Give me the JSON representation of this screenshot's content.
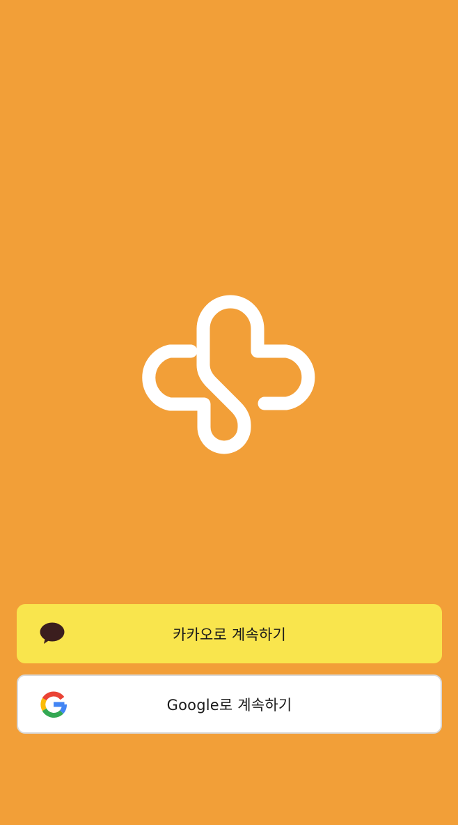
{
  "splash": {
    "logo_icon": "app-logo-plus-icon"
  },
  "login": {
    "kakao": {
      "label": "카카오로 계속하기",
      "icon": "kakao-speech-bubble-icon",
      "bg_color": "#f9e54d"
    },
    "google": {
      "label": "Google로 계속하기",
      "icon": "google-g-icon",
      "bg_color": "#ffffff"
    }
  },
  "colors": {
    "background": "#f29f38",
    "logo": "#ffffff"
  }
}
